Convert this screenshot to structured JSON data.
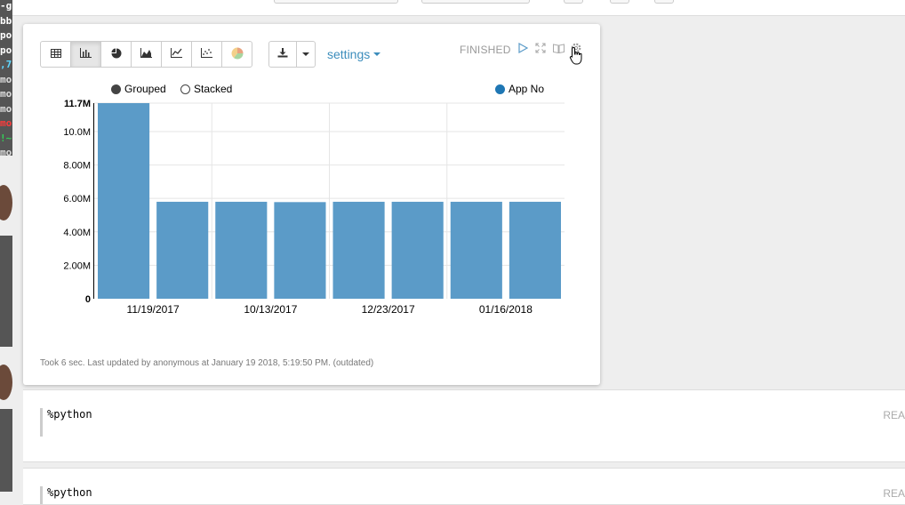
{
  "terminal": {
    "lines": [
      {
        "text": "-g",
        "color": "#ffffff"
      },
      {
        "text": "bb",
        "color": "#ffffff"
      },
      {
        "text": "po",
        "color": "#ffffff"
      },
      {
        "text": "po",
        "color": "#ffffff"
      },
      {
        "text": ",7",
        "color": "#5fd7ff"
      },
      {
        "text": "mo",
        "color": "#dddddd"
      },
      {
        "text": "mo",
        "color": "#dddddd"
      },
      {
        "text": "mo",
        "color": "#dddddd"
      },
      {
        "text": "mo",
        "color": "#ff3b3b"
      },
      {
        "text": "!~",
        "color": "#34d058"
      },
      {
        "text": "mo",
        "color": "#dddddd"
      }
    ]
  },
  "paragraph": {
    "toolbar": {
      "chart_types": [
        {
          "icon": "table-icon",
          "active": false
        },
        {
          "icon": "bar-chart-icon",
          "active": true
        },
        {
          "icon": "pie-chart-icon",
          "active": false
        },
        {
          "icon": "area-chart-icon",
          "active": false
        },
        {
          "icon": "line-chart-icon",
          "active": false
        },
        {
          "icon": "scatter-chart-icon",
          "active": false
        },
        {
          "icon": "pie-color-icon",
          "active": false
        }
      ],
      "download_icon": "download-icon",
      "settings_label": "settings"
    },
    "status": "FINISHED",
    "right_icons": [
      "run-icon",
      "expand-icon",
      "book-icon",
      "gear-icon"
    ],
    "legend": {
      "grouped": "Grouped",
      "stacked": "Stacked",
      "series": "App No"
    },
    "footer": "Took 6 sec. Last updated by anonymous at January 19 2018, 5:19:50 PM. (outdated)"
  },
  "chart_data": {
    "type": "bar",
    "categories": [
      "",
      "11/19/2017",
      "",
      "10/13/2017",
      "",
      "12/23/2017",
      "",
      "01/16/2018"
    ],
    "x_tick_labels": [
      "11/19/2017",
      "10/13/2017",
      "12/23/2017",
      "01/16/2018"
    ],
    "series": [
      {
        "name": "App No",
        "values": [
          11700000,
          5800000,
          5800000,
          5780000,
          5800000,
          5800000,
          5800000,
          5800000
        ]
      }
    ],
    "y_ticks": [
      "0",
      "2.00M",
      "4.00M",
      "6.00M",
      "8.00M",
      "10.0M",
      "11.7M"
    ],
    "ylim": [
      0,
      11700000
    ],
    "grid": true,
    "bar_color": "#5b9bc8",
    "legend_placement": "top-right"
  },
  "other_paragraphs": [
    {
      "code": "%python",
      "status": "REA"
    },
    {
      "code": "%python",
      "status": "REA"
    }
  ]
}
